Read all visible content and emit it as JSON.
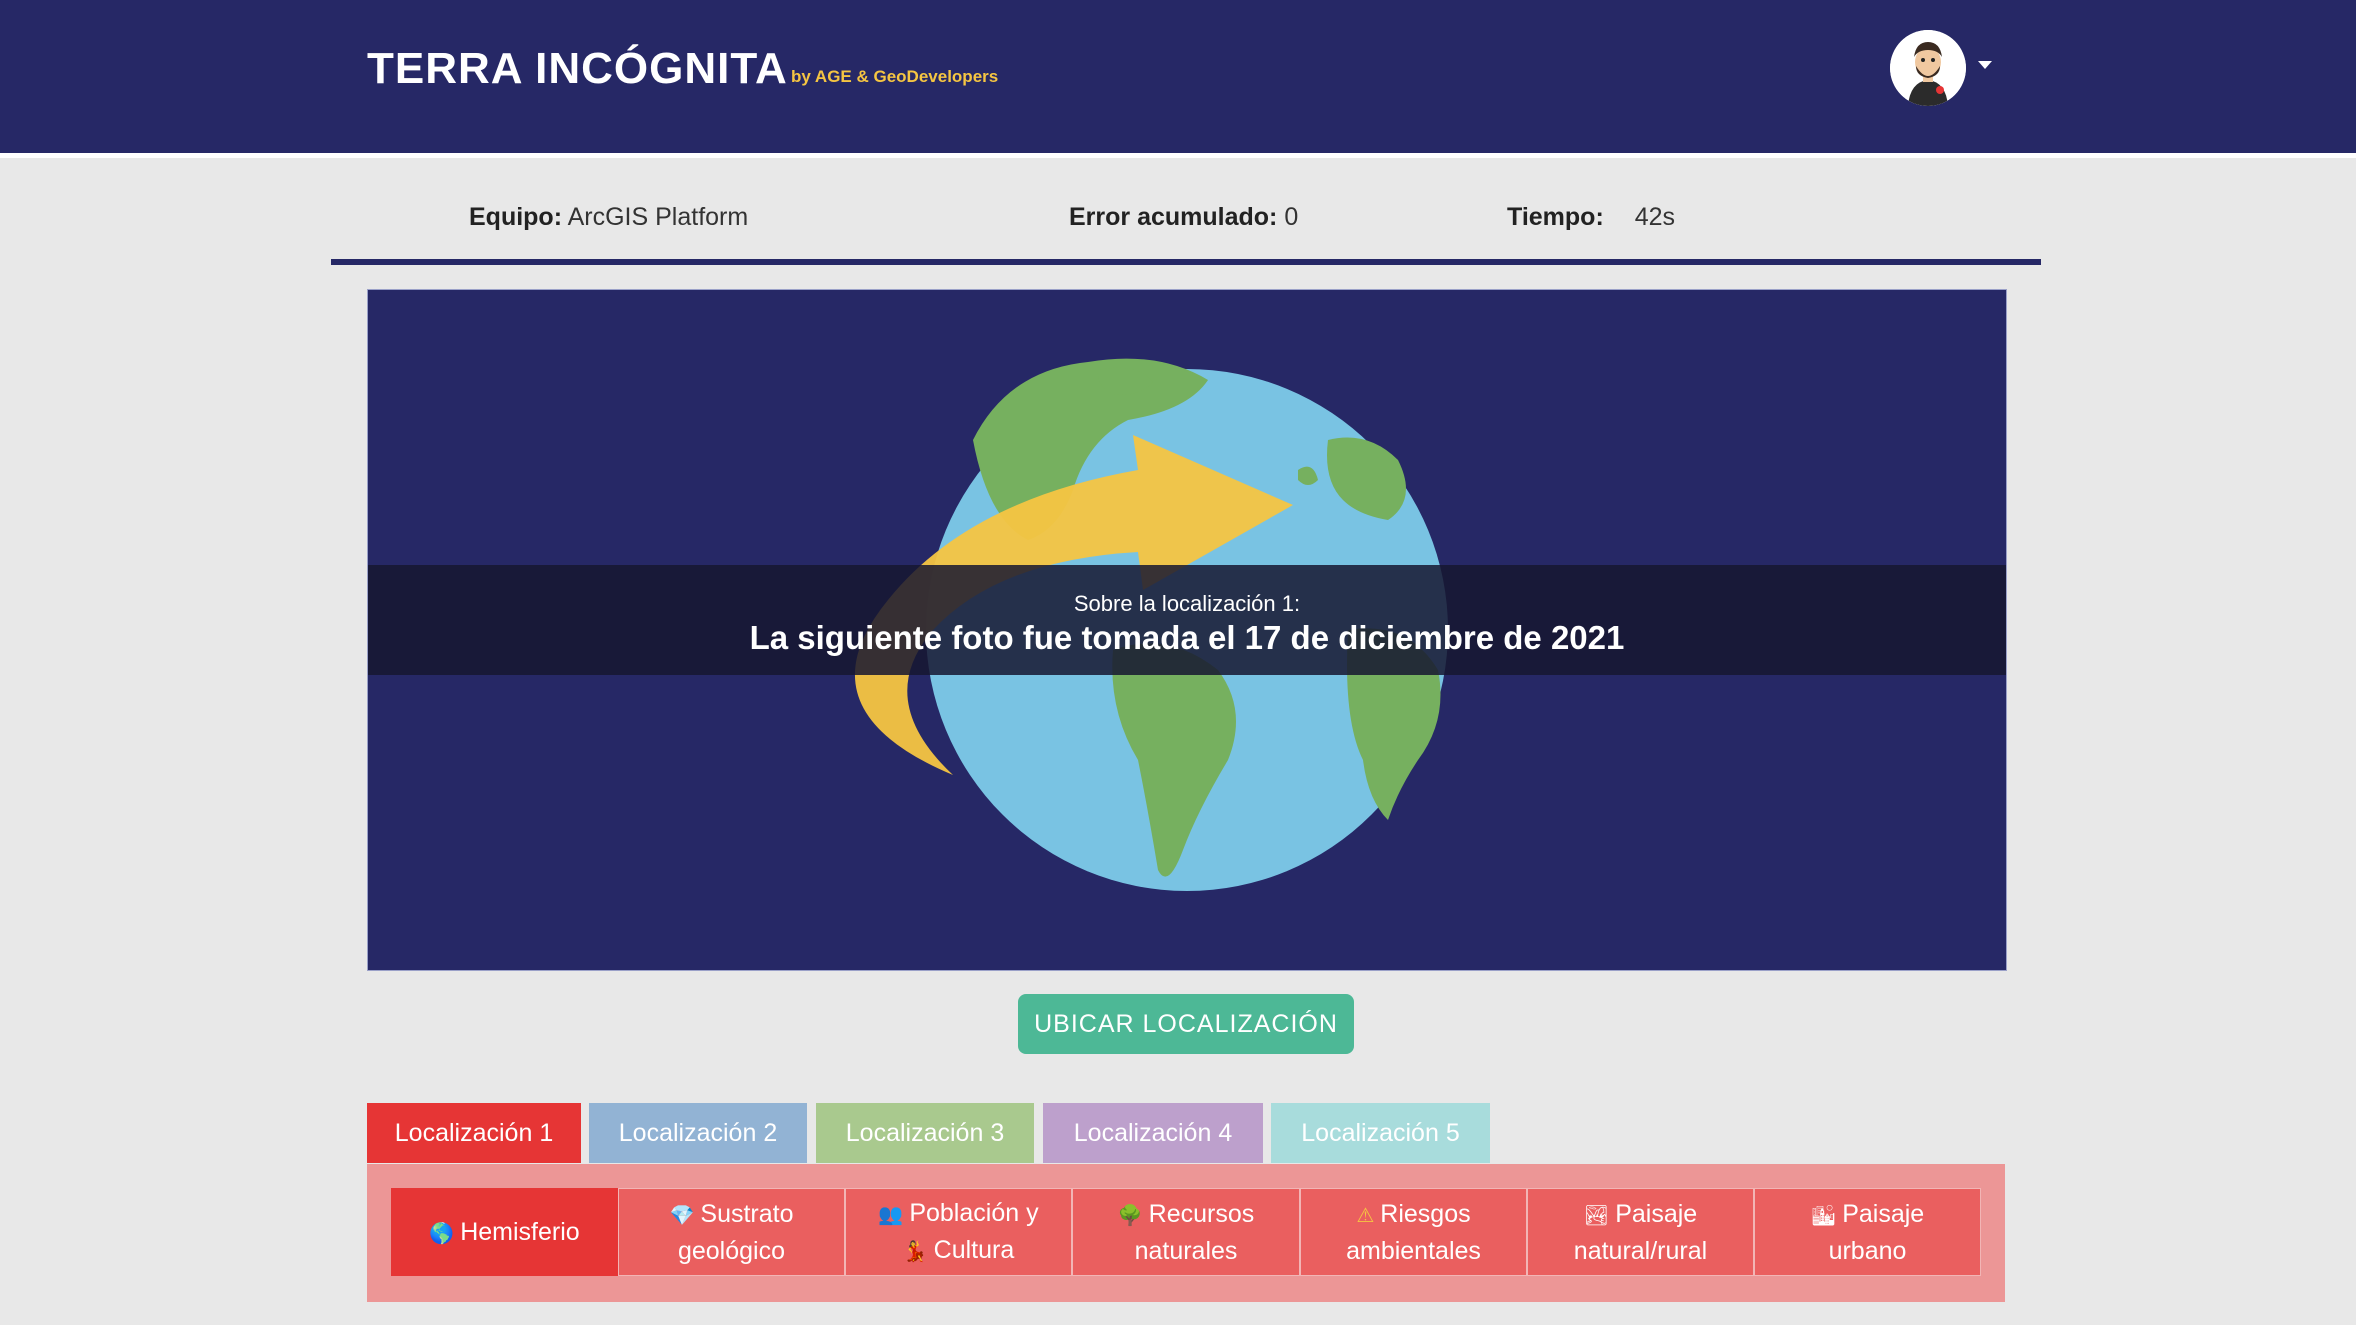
{
  "header": {
    "title": "TERRA INCÓGNITA",
    "subtitle": "by AGE & GeoDevelopers"
  },
  "stats": {
    "team_label": "Equipo:",
    "team_value": "ArcGIS Platform",
    "error_label": "Error acumulado:",
    "error_value": "0",
    "time_label": "Tiempo:",
    "time_value": "42s"
  },
  "banner": {
    "subtitle": "Sobre la localización 1:",
    "message": "La siguiente foto fue tomada el 17 de diciembre de 2021"
  },
  "locate_button": "UBICAR LOCALIZACIÓN",
  "tabs": [
    {
      "label": "Localización 1",
      "color": "#e63535"
    },
    {
      "label": "Localización 2",
      "color": "#92b3d4"
    },
    {
      "label": "Localización 3",
      "color": "#a9c98e"
    },
    {
      "label": "Localización 4",
      "color": "#bda0cc"
    },
    {
      "label": "Localización 5",
      "color": "#a8dcdc"
    }
  ],
  "categories": [
    {
      "icon": "🌎",
      "line1": "Hemisferio",
      "line2": ""
    },
    {
      "icon": "💎",
      "line1": "Sustrato",
      "line2": "geológico"
    },
    {
      "icon": "👥",
      "line1": "Población y",
      "line2": "Cultura"
    },
    {
      "icon": "🌳",
      "line1": "Recursos",
      "line2": "naturales"
    },
    {
      "icon": "⚠",
      "line1": "Riesgos",
      "line2": "ambientales"
    },
    {
      "icon": "🏞",
      "line1": "Paisaje",
      "line2": "natural/rural"
    },
    {
      "icon": "🏙",
      "line1": "Paisaje",
      "line2": "urbano"
    }
  ],
  "colors": {
    "navy": "#262866",
    "accent": "#f5c542",
    "button": "#4db896",
    "active_red": "#e63535"
  }
}
